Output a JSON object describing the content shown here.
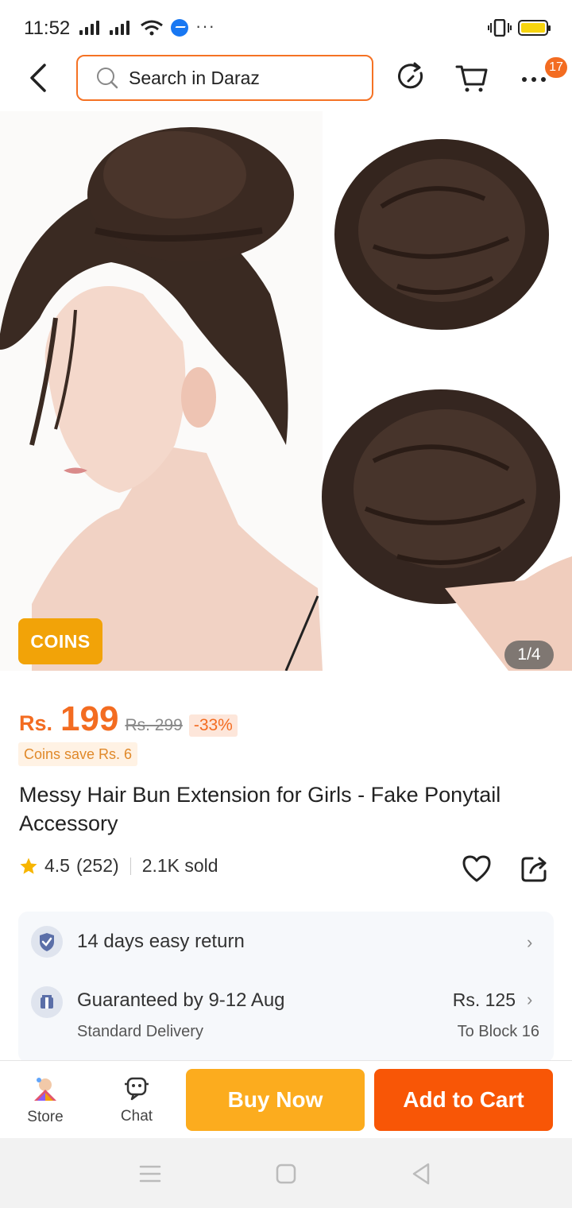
{
  "status_bar": {
    "time": "11:52",
    "more": "···"
  },
  "header": {
    "search_placeholder": "Search in Daraz",
    "cart_badge": "17",
    "icons": [
      "back-icon",
      "search-icon",
      "refresh-icon",
      "cart-icon",
      "more-icon"
    ]
  },
  "gallery": {
    "coins_label": "COINS",
    "counter": "1/4"
  },
  "product": {
    "currency": "Rs.",
    "price": "199",
    "old_price": "Rs. 299",
    "discount": "-33%",
    "coins_save": "Coins save Rs. 6",
    "title": "Messy Hair Bun Extension for Girls - Fake Ponytail Accessory",
    "rating": "4.5",
    "reviews": "(252)",
    "sold": "2.1K sold"
  },
  "services": {
    "return_label": "14 days easy return",
    "delivery_label": "Guaranteed by 9-12 Aug",
    "delivery_type": "Standard Delivery",
    "delivery_price": "Rs. 125",
    "delivery_to": "To Block 16"
  },
  "actions": {
    "store_label": "Store",
    "chat_label": "Chat",
    "buy_now": "Buy Now",
    "add_to_cart": "Add to Cart"
  },
  "colors": {
    "accent": "#f36c21",
    "buy_now": "#fcac1e",
    "add_to_cart": "#f85606",
    "coins_badge": "#f2a308"
  }
}
